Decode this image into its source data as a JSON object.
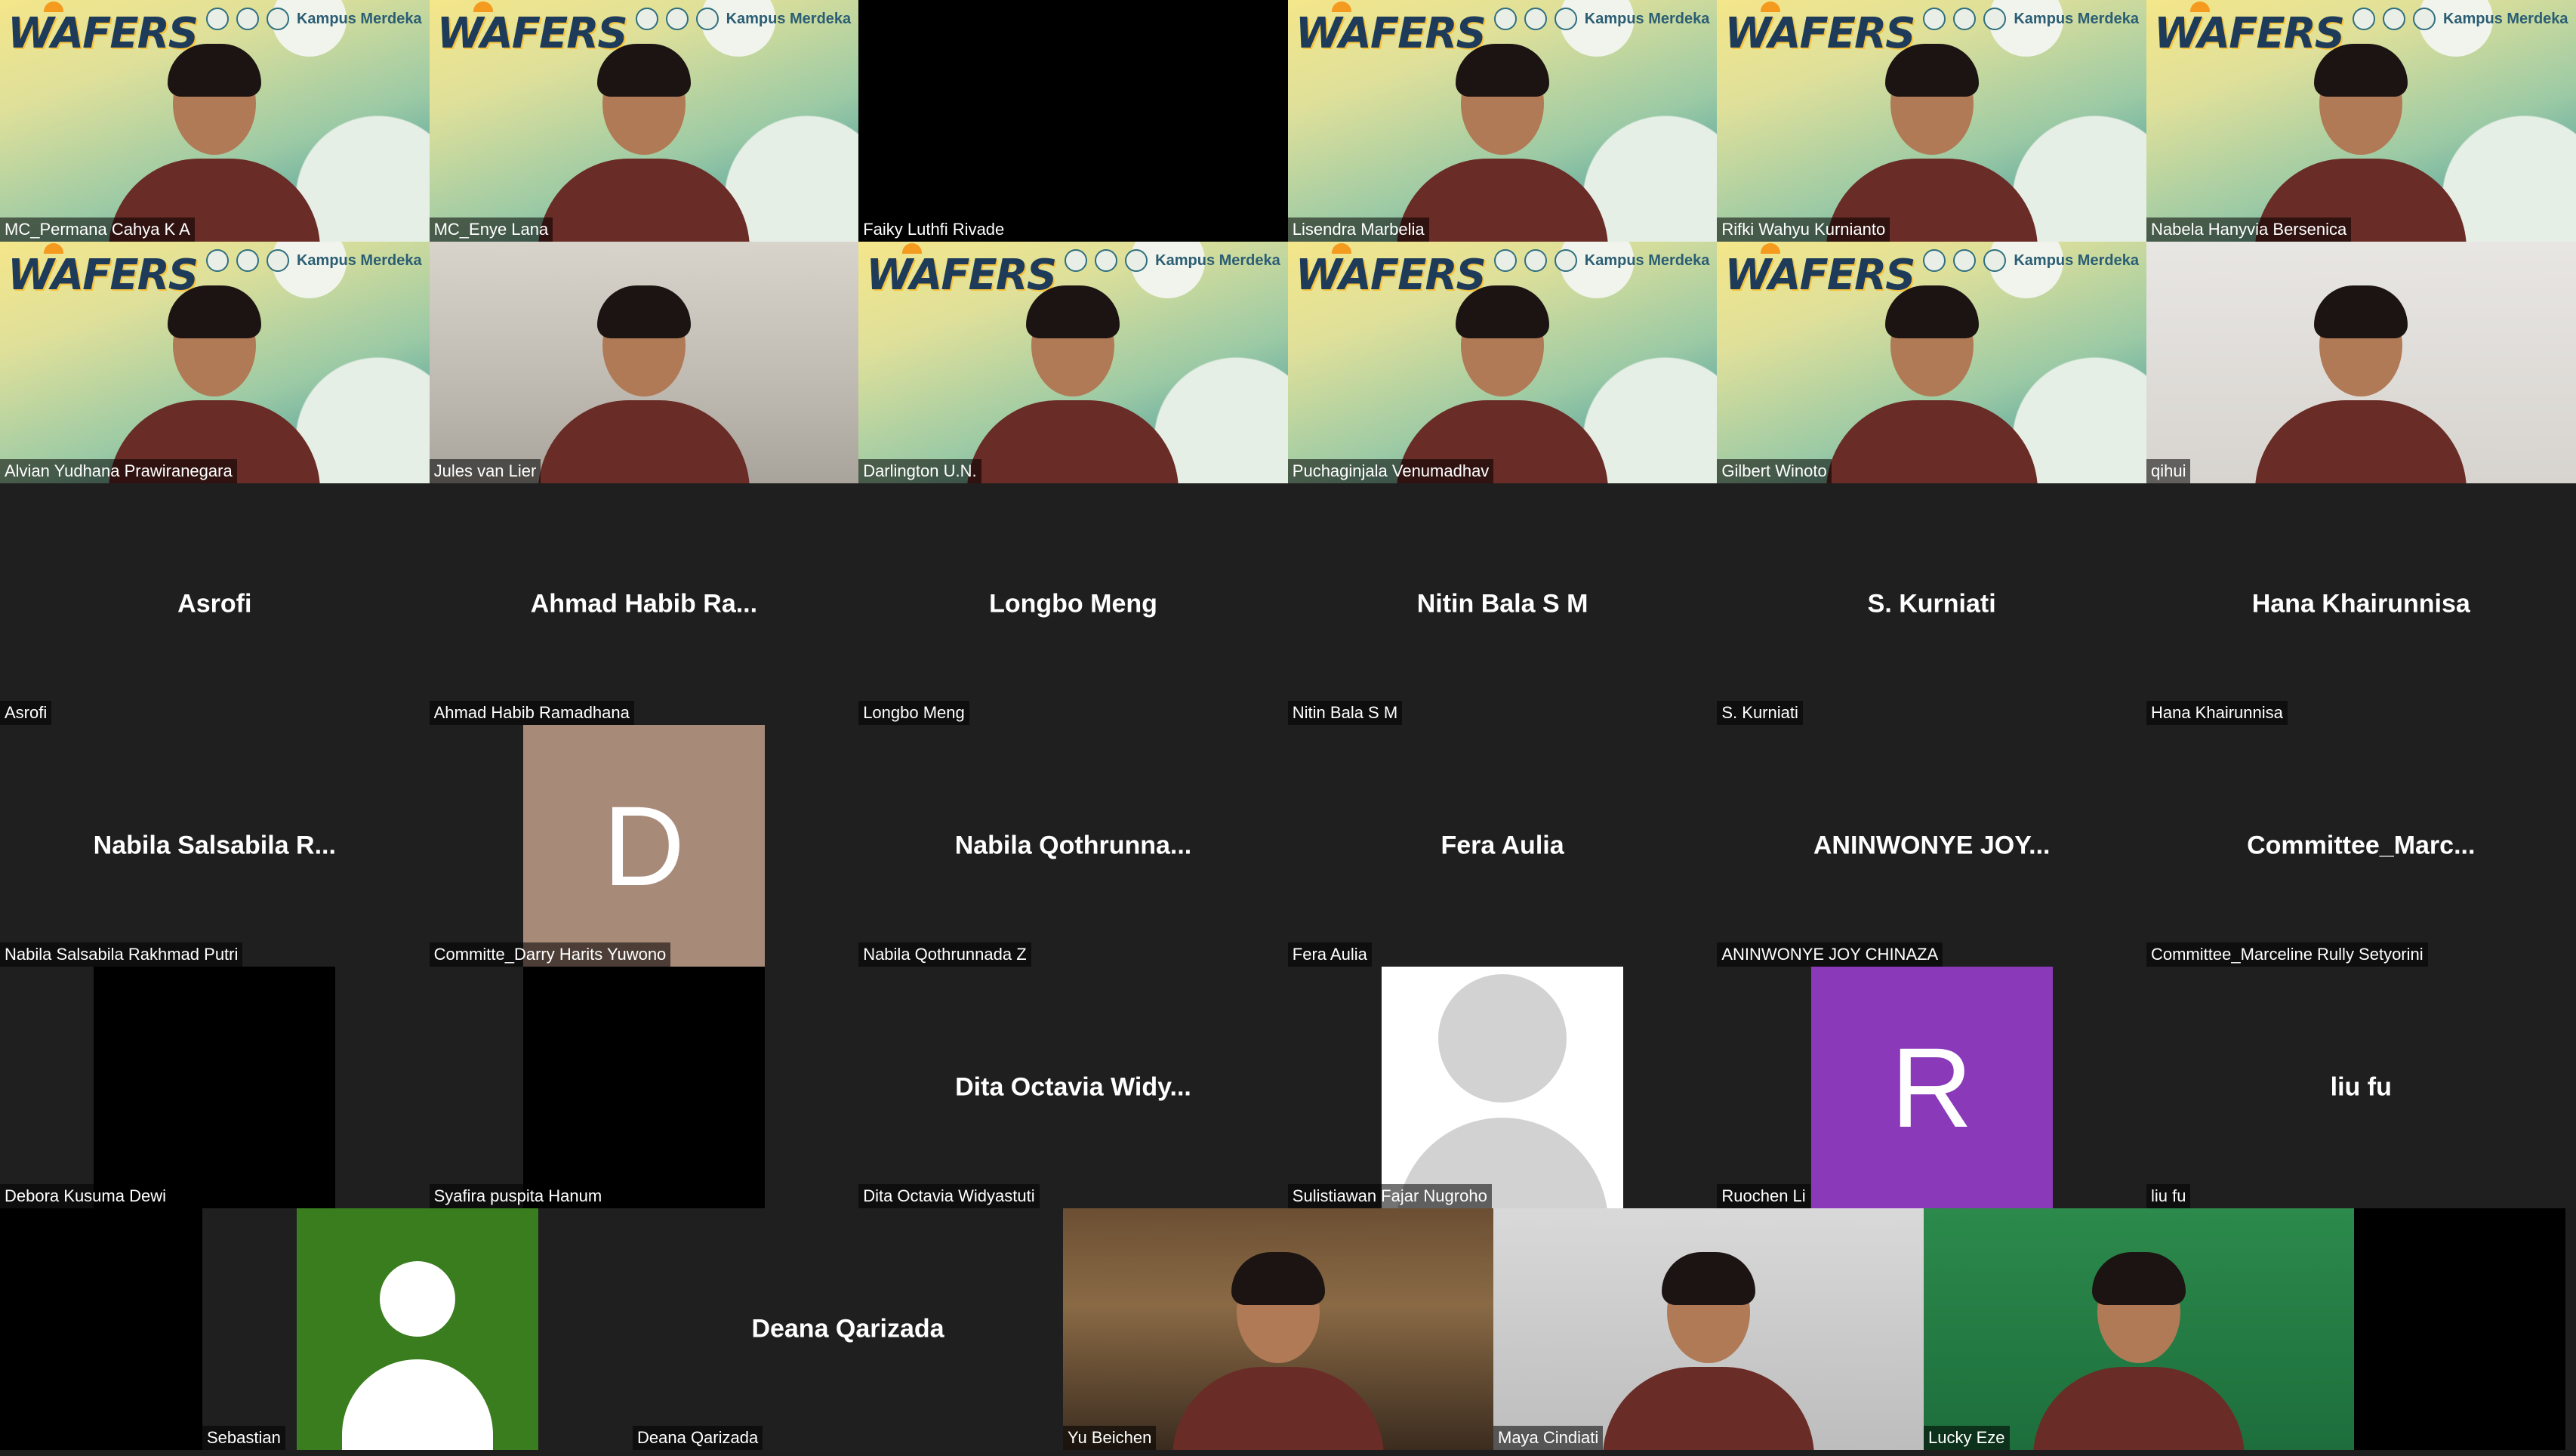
{
  "banner": {
    "logo_text": "WAFERS",
    "sponsor_text": "Kampus Merdeka"
  },
  "rows": [
    [
      {
        "name": "MC_Permana Cahya K A",
        "style": "wafers"
      },
      {
        "name": "MC_Enye Lana",
        "style": "wafers"
      },
      {
        "name": "Faiky Luthfi Rivade",
        "style": "black"
      },
      {
        "name": "Lisendra Marbelia",
        "style": "wafers"
      },
      {
        "name": "Rifki Wahyu Kurnianto",
        "style": "wafers"
      },
      {
        "name": "Nabela Hanyvia Bersenica",
        "style": "wafers"
      }
    ],
    [
      {
        "name": "Alvian Yudhana Prawiranegara",
        "style": "wafers"
      },
      {
        "name": "Jules van Lier",
        "style": "room"
      },
      {
        "name": "Darlington U.N.",
        "style": "wafers"
      },
      {
        "name": "Puchaginjala Venumadhav",
        "style": "wafers"
      },
      {
        "name": "Gilbert Winoto",
        "style": "wafers"
      },
      {
        "name": "qihui",
        "style": "dim"
      }
    ],
    [
      {
        "name": "Asrofi",
        "display": "Asrofi",
        "style": "dark"
      },
      {
        "name": "Ahmad Habib Ramadhana",
        "display": "Ahmad Habib Ra...",
        "style": "dark"
      },
      {
        "name": "Longbo Meng",
        "display": "Longbo Meng",
        "style": "dark"
      },
      {
        "name": "Nitin Bala S M",
        "display": "Nitin Bala S M",
        "style": "dark"
      },
      {
        "name": "S. Kurniati",
        "display": "S. Kurniati",
        "style": "dark"
      },
      {
        "name": "Hana Khairunnisa",
        "display": "Hana Khairunnisa",
        "style": "dark"
      }
    ],
    [
      {
        "name": "Nabila Salsabila Rakhmad Putri",
        "display": "Nabila Salsabila R...",
        "style": "dark"
      },
      {
        "name": "Committe_Darry Harits Yuwono",
        "avatar_letter": "D",
        "avatar_color": "#a88a78",
        "style": "dark"
      },
      {
        "name": "Nabila Qothrunnada Z",
        "display": "Nabila Qothrunna...",
        "style": "dark"
      },
      {
        "name": "Fera Aulia",
        "display": "Fera Aulia",
        "style": "dark"
      },
      {
        "name": "ANINWONYE JOY CHINAZA",
        "display": "ANINWONYE JOY...",
        "style": "dark"
      },
      {
        "name": "Committee_Marceline Rully Setyorini",
        "display": "Committee_Marc...",
        "style": "dark"
      }
    ],
    [
      {
        "name": "Debora Kusuma Dewi",
        "style": "black-block"
      },
      {
        "name": "Syafira puspita Hanum",
        "style": "black-block"
      },
      {
        "name": "Dita Octavia Widyastuti",
        "display": "Dita Octavia Widy...",
        "style": "dark"
      },
      {
        "name": "Sulistiawan Fajar Nugroho",
        "style": "generic-avatar"
      },
      {
        "name": "Ruochen Li",
        "avatar_letter": "R",
        "avatar_color": "#8a3ab9",
        "style": "dark"
      },
      {
        "name": "liu fu",
        "display": "liu fu",
        "style": "dark"
      }
    ]
  ],
  "bottom_row": [
    {
      "name": "",
      "style": "black"
    },
    {
      "name": "Sebastian",
      "style": "green-avatar"
    },
    {
      "name": "Deana Qarizada",
      "display": "Deana Qarizada",
      "style": "dark"
    },
    {
      "name": "Yu Beichen",
      "style": "shop"
    },
    {
      "name": "Maya Cindiati",
      "style": "gray"
    },
    {
      "name": "Lucky Eze",
      "style": "greenart"
    },
    {
      "name": "",
      "style": "black"
    }
  ]
}
